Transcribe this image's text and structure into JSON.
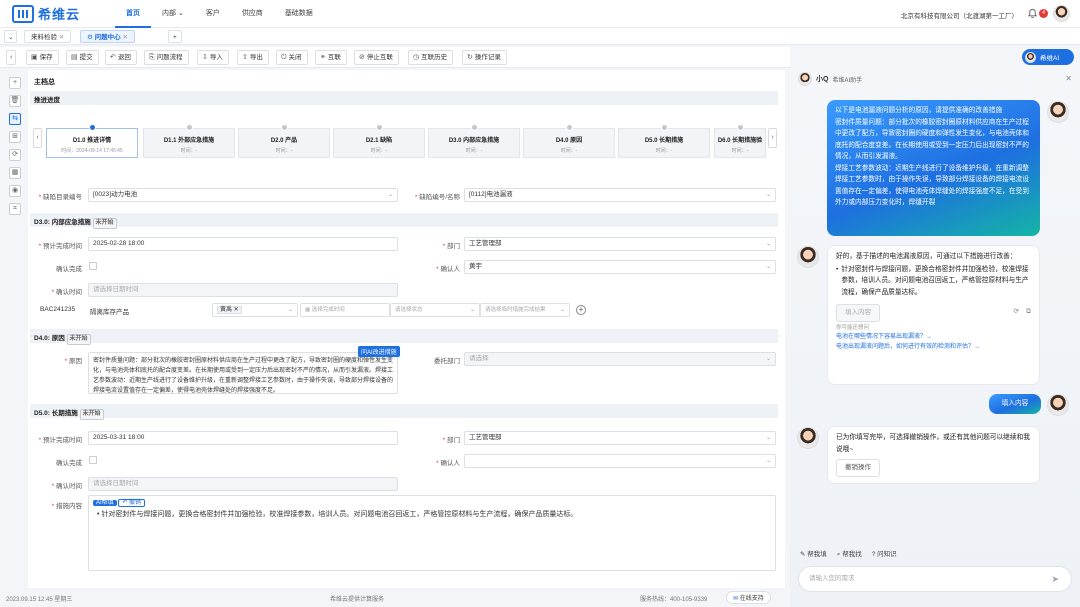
{
  "app": {
    "brand": "希维云",
    "nav": [
      "首页",
      "内部",
      "客户",
      "供应商",
      "基础数据"
    ],
    "company": "北京有科技有限公司（北渡湖第一工厂）",
    "notif_count": "4"
  },
  "tabs": [
    "来料检验",
    "问题中心"
  ],
  "toolbar": [
    "保存",
    "提交",
    "退回",
    "问题流程",
    "导入",
    "导出",
    "关闭",
    "互联",
    "停止互联",
    "互联历史",
    "操作记录"
  ],
  "ai_button": "希维AI",
  "main": {
    "section_main": "主档总",
    "progress_label": "推进进度",
    "steps": [
      {
        "title": "D1.0 推进详情",
        "sub": "时间：2024-09-14 17:45:45"
      },
      {
        "title": "D1.1 外部应急措施",
        "sub": "时间：-"
      },
      {
        "title": "D2.0 产品",
        "sub": "时间：-"
      },
      {
        "title": "D2.1 缺陷",
        "sub": "时间：-"
      },
      {
        "title": "D3.0 内部应急措施",
        "sub": "时间：-"
      },
      {
        "title": "D4.0 原因",
        "sub": "时间：-"
      },
      {
        "title": "D5.0 长期措施",
        "sub": "时间：-"
      },
      {
        "title": "D6.0 长期措施验",
        "sub": "时间：-"
      }
    ],
    "defect_catalog_label": "缺陷目录编号",
    "defect_catalog_value": "[0023]动力电池",
    "defect_code_label": "缺陷编号/名称",
    "defect_code_value": "[0112]电池漏液",
    "d3": {
      "title": "D3.0: 内部应急措施",
      "status": "未开始",
      "due_label": "预计完成时间",
      "due_value": "2025-02-28 18:00",
      "dept_label": "部门",
      "dept_value": "工艺管理部",
      "confirm_label": "确认完成",
      "confirmer_label": "确认人",
      "confirmer_value": "黄宇",
      "confirm_time_label": "确认时间",
      "confirm_time_ph": "请选择日期时间",
      "batch": "BAC241235",
      "batch_desc": "隔离库存产品",
      "person_tag": "黄禹",
      "time_ph": "选择完成时间",
      "status_ph": "请选择状态",
      "result_ph": "请选择临时措施完成结果"
    },
    "d4": {
      "title": "D4.0: 原因",
      "status": "未开始",
      "reason_label": "原因",
      "reason_text": "密封件质量问题：部分批次的橡胶密封圈原材料供应商在生产过程中更改了配方，导致密封圈的硬度和弹性发生变化，与电池壳体和底托的配合度变差。在长期使用或受到一定压力后出现密封不严的情况，从而引发漏液。焊接工艺参数波动：近期生产线进行了设备维护升级，在重新调整焊接工艺参数时，由于操作失误，导致部分焊接设备的焊接电流设置值存在一定偏差，使得电池壳体焊缝处的焊接强度不足。",
      "ai_tag": "问AI改进措施",
      "dept_label": "委托部门",
      "dept_ph": "请选择"
    },
    "d5": {
      "title": "D5.0: 长期措施",
      "status": "未开始",
      "due_label": "预计完成时间",
      "due_value": "2025-03-31 18:00",
      "dept_label": "部门",
      "dept_value": "工艺管理部",
      "confirm_label": "确认完成",
      "confirmer_label": "确认人",
      "confirm_time_label": "确认时间",
      "confirm_time_ph": "请选择日期时间",
      "content_label": "措施内容",
      "ai_tag": "AI帮填",
      "undo": "撤销",
      "content_text": "针对密封件与焊接问题，更换合格密封件并加强检验，校准焊接参数，培训人员。对问题电池召回返工，严格管控原材料与生产流程，确保产品质量达标。"
    }
  },
  "footer": {
    "datetime": "2023.09.15 12:45 星期三",
    "center": "希维云提供计算服务",
    "hotline": "服务热线：400-105-9339",
    "support": "在线支持"
  },
  "chat": {
    "name": "小Q",
    "subtitle": "希维AI助手",
    "user_msg": "以下是电池漏液问题分析的原因，请提供准确的改善措施\n密封件质量问题：部分批次的橡胶密封圈原材料供应商在生产过程中更改了配方，导致密封圈的硬度和弹性发生变化，与电池壳体和底托的配合度变差。在长期使用或受到一定压力后出现密封不严的情况，从而引发漏液。\n焊接工艺参数波动：近期生产线进行了设备维护升级，在重新调整焊接工艺参数时，由于操作失误，导致部分焊接设备的焊接电流设置值存在一定偏差，使得电池壳体焊缝处的焊接强度不足，在受到外力或内部压力变化时，焊缝开裂",
    "ai_msg1": "好的，基于描述的电池漏液原因，可通过以下措施进行改善：",
    "ai_bullet": "针对密封件与焊接问题，更换合格密封件并加强检验，校准焊接参数，培训人员。对问题电池召回返工，严格管控原材料与生产流程，确保产品质量达标。",
    "fill_btn": "填入内容",
    "suggest_label": "你可能还想问",
    "suggest1": "电池在哪些情况下容易出现漏液？→",
    "suggest2": "电池出现漏液问题后，如何进行有效的检测和评估？→",
    "user_msg2": "填入内容",
    "ai_msg2": "已为你填写完毕，可选择撤销操作，或还有其他问题可以继续和我说哦~",
    "undo_btn": "撤销操作",
    "quick": [
      "帮我填",
      "帮我找",
      "问知识"
    ],
    "input_ph": "请输入您的需求"
  }
}
